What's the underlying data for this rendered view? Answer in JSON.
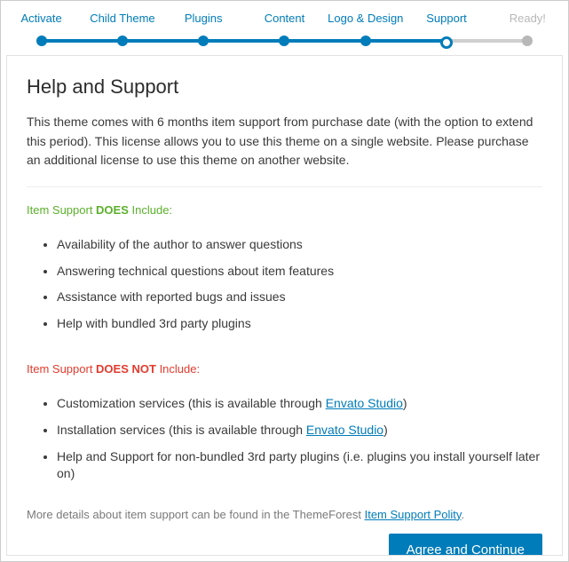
{
  "stepper": {
    "steps": [
      {
        "label": "Activate",
        "state": "done"
      },
      {
        "label": "Child Theme",
        "state": "done"
      },
      {
        "label": "Plugins",
        "state": "done"
      },
      {
        "label": "Content",
        "state": "done"
      },
      {
        "label": "Logo & Design",
        "state": "done"
      },
      {
        "label": "Support",
        "state": "current"
      },
      {
        "label": "Ready!",
        "state": "disabled"
      }
    ]
  },
  "page": {
    "title": "Help and Support",
    "intro": "This theme comes with 6 months item support from purchase date (with the option to extend this period). This license allows you to use this theme on a single website. Please purchase an additional license to use this theme on another website."
  },
  "includes": {
    "heading_prefix": "Item Support ",
    "heading_bold": "DOES",
    "heading_suffix": " Include:",
    "items": [
      "Availability of the author to answer questions",
      "Answering technical questions about item features",
      "Assistance with reported bugs and issues",
      "Help with bundled 3rd party plugins"
    ]
  },
  "excludes": {
    "heading_prefix": "Item Support ",
    "heading_bold": "DOES NOT",
    "heading_suffix": " Include:",
    "items": [
      {
        "prefix": "Customization services (this is available through ",
        "link": "Envato Studio",
        "suffix": ")"
      },
      {
        "prefix": "Installation services (this is available through ",
        "link": "Envato Studio",
        "suffix": ")"
      },
      {
        "text": "Help and Support for non-bundled 3rd party plugins (i.e. plugins you install yourself later on)"
      }
    ]
  },
  "footnote": {
    "prefix": "More details about item support can be found in the ThemeForest ",
    "link": "Item Support Polity",
    "suffix": "."
  },
  "actions": {
    "continue": "Agree and Continue"
  }
}
